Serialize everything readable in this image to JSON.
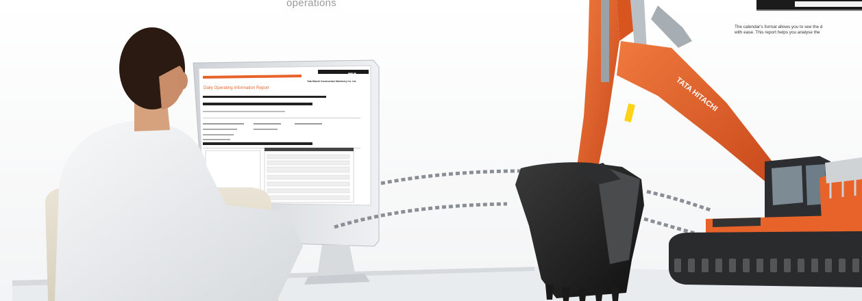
{
  "caption": "operations",
  "note": {
    "line1": "The calendar's format allows you to see the d",
    "line2": "with ease. This report helps you analyse the"
  },
  "report": {
    "header_right": "Tata Hitachi Construction Machinery Co. Ltd.",
    "title": "Daily Operating Information Report",
    "boom_label": "TATA HITACHI"
  },
  "colors": {
    "excavator_orange": "#e8632a",
    "report_orange": "#e8632a",
    "bucket_black": "#1e1e1e",
    "dash_gray": "#8a8f96"
  }
}
